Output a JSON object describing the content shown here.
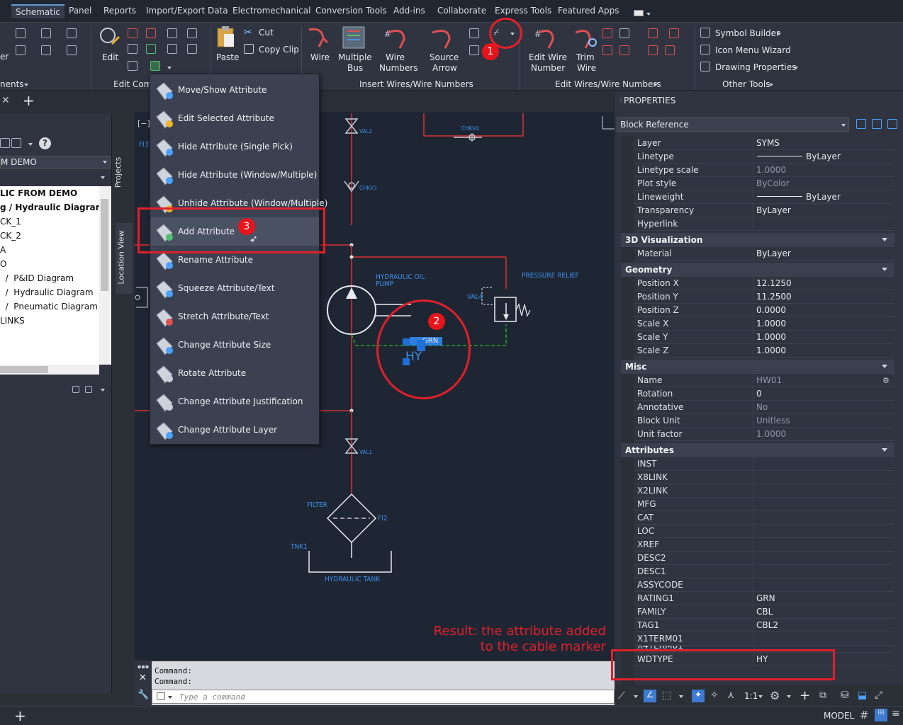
{
  "tabs": [
    "Schematic",
    "Panel",
    "Reports",
    "Import/Export Data",
    "Electromechanical",
    "Conversion Tools",
    "Add-ins",
    "Collaborate",
    "Express Tools",
    "Featured Apps"
  ],
  "ribbon": {
    "edit_label": "Edit",
    "cut_label": "Cut",
    "copy_clip_label": "Copy Clip",
    "paste_label": "Paste",
    "wire_label": "Wire",
    "multiple_bus_label": "Multiple\nBus",
    "multiple_label": "Multiple",
    "bus_label": "Bus",
    "wire_numbers_l1": "Wire",
    "wire_numbers_l2": "Numbers",
    "source_l1": "Source",
    "source_l2": "Arrow",
    "edit_wire_l1": "Edit Wire",
    "edit_wire_l2": "Number",
    "trim_l1": "Trim",
    "trim_l2": "Wire",
    "symbol_builder": "Symbol Builder",
    "icon_menu_wizard": "Icon Menu  Wizard",
    "drawing_properties": "Drawing  Properties",
    "panel_components": "nents",
    "panel_edit_comp": "Edit Comp",
    "panel_insert_wires": "Insert Wires/Wire Numbers",
    "panel_edit_wires": "Edit Wires/Wire Numbers",
    "panel_other_tools": "Other Tools"
  },
  "left": {
    "project_name": "M DEMO",
    "tree": [
      "LIC FROM DEMO",
      "g  /  Hydraulic Diagram",
      "CK_1",
      "CK_2",
      "A",
      "O",
      "  /  P&ID Diagram",
      "  /  Hydraulic Diagram",
      "  /  Pneumatic Diagram",
      "LINKS"
    ],
    "vtab_projects": "Projects",
    "vtab_location": "Location View"
  },
  "menu": {
    "items": [
      "Move/Show Attribute",
      "Edit Selected Attribute",
      "Hide Attribute (Single Pick)",
      "Hide Attribute (Window/Multiple)",
      "Unhide Attribute (Window/Multiple)",
      "Add Attribute",
      "Rename Attribute",
      "Squeeze Attribute/Text",
      "Stretch Attribute/Text",
      "Change Attribute Size",
      "Rotate Attribute",
      "Change Attribute Justification",
      "Change Attribute Layer"
    ]
  },
  "canvas": {
    "viewport_label": "[−]",
    "fi3": "FI3",
    "val2": "VAL2",
    "chkv4": "CHKV4",
    "chkv3": "CHKV3",
    "hydraulic_oil_pump": "HYDRAULIC OIL\nPUMP",
    "hydraulic_oil": "HYDRAULIC OIL",
    "pump": "PUMP",
    "pressure_relief": "PRESSURE RELIEF",
    "val4": "VAL4",
    "grn": "GRN",
    "hy": "HY",
    "val1": "VAL1",
    "filter": "FILTER",
    "fi2": "FI2",
    "tnk1": "TNK1",
    "hydraulic_tank": "HYDRAULIC TANK"
  },
  "annotation": {
    "line1": "Result: the attribute added",
    "line2": "to the cable marker"
  },
  "badges": [
    "1",
    "2",
    "3"
  ],
  "command": {
    "line1": "Command:",
    "line2": "Command:",
    "placeholder": "Type a command"
  },
  "status": {
    "model": "MODEL",
    "scale": "1:1"
  },
  "properties": {
    "title": "PROPERTIES",
    "selector": "Block Reference",
    "general": [
      {
        "k": "Layer",
        "v": "SYMS",
        "dim": false
      },
      {
        "k": "Linetype",
        "v": "ByLayer",
        "dim": false
      },
      {
        "k": "Linetype scale",
        "v": "1.0000",
        "dim": true
      },
      {
        "k": "Plot style",
        "v": "ByColor",
        "dim": true
      },
      {
        "k": "Lineweight",
        "v": "ByLayer",
        "dim": false
      },
      {
        "k": "Transparency",
        "v": "ByLayer",
        "dim": false
      },
      {
        "k": "Hyperlink",
        "v": "",
        "dim": false
      }
    ],
    "sec_3d": "3D Visualization",
    "viz": [
      {
        "k": "Material",
        "v": "ByLayer",
        "dim": false
      }
    ],
    "sec_geometry": "Geometry",
    "geometry": [
      {
        "k": "Position X",
        "v": "12.1250",
        "dim": false
      },
      {
        "k": "Position Y",
        "v": "11.2500",
        "dim": false
      },
      {
        "k": "Position Z",
        "v": "0.0000",
        "dim": false
      },
      {
        "k": "Scale X",
        "v": "1.0000",
        "dim": false
      },
      {
        "k": "Scale Y",
        "v": "1.0000",
        "dim": false
      },
      {
        "k": "Scale Z",
        "v": "1.0000",
        "dim": false
      }
    ],
    "sec_misc": "Misc",
    "misc": [
      {
        "k": "Name",
        "v": "HW01",
        "dim": true
      },
      {
        "k": "Rotation",
        "v": "0",
        "dim": false
      },
      {
        "k": "Annotative",
        "v": "No",
        "dim": true
      },
      {
        "k": "Block Unit",
        "v": "Unitless",
        "dim": true
      },
      {
        "k": "Unit factor",
        "v": "1.0000",
        "dim": true
      }
    ],
    "sec_attributes": "Attributes",
    "attributes": [
      {
        "k": "INST",
        "v": ""
      },
      {
        "k": "X8LINK",
        "v": ""
      },
      {
        "k": "X2LINK",
        "v": ""
      },
      {
        "k": "MFG",
        "v": ""
      },
      {
        "k": "CAT",
        "v": ""
      },
      {
        "k": "LOC",
        "v": ""
      },
      {
        "k": "XREF",
        "v": ""
      },
      {
        "k": "DESC2",
        "v": ""
      },
      {
        "k": "DESC1",
        "v": ""
      },
      {
        "k": "ASSYCODE",
        "v": ""
      },
      {
        "k": "RATING1",
        "v": "GRN"
      },
      {
        "k": "FAMILY",
        "v": "CBL"
      },
      {
        "k": "TAG1",
        "v": "CBL2"
      },
      {
        "k": "X1TERM01",
        "v": ""
      },
      {
        "k": "X4TERM01",
        "v": ""
      },
      {
        "k": "WDTYPE",
        "v": "HY"
      }
    ]
  }
}
